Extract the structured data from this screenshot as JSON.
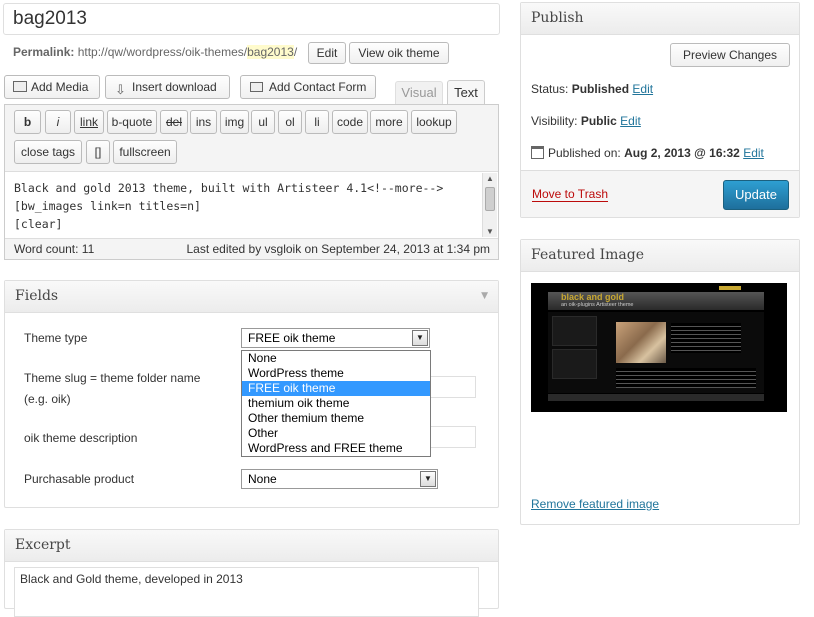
{
  "post": {
    "title": "bag2013",
    "permalink_label": "Permalink:",
    "permalink_base": "http://qw/wordpress/oik-themes/",
    "permalink_slug": "bag2013",
    "permalink_end": "/",
    "edit_button": "Edit",
    "view_button": "View oik theme"
  },
  "media_buttons": {
    "add_media": "Add Media",
    "insert_download": "Insert download",
    "add_contact_form": "Add Contact Form"
  },
  "editor_tabs": {
    "visual": "Visual",
    "text": "Text"
  },
  "quicktags": [
    "b",
    "i",
    "link",
    "b-quote",
    "del",
    "ins",
    "img",
    "ul",
    "ol",
    "li",
    "code",
    "more",
    "lookup",
    "close tags",
    "[]",
    "fullscreen"
  ],
  "editor": {
    "lines": [
      "Black and gold 2013 theme, built with Artisteer 4.1<!--more-->",
      "[bw_images link=n titles=n]",
      "[clear]"
    ],
    "word_count": "Word count: 11",
    "last_edited": "Last edited by vsgloik on September 24, 2013 at 1:34 pm"
  },
  "fields": {
    "title": "Fields",
    "theme_type_label": "Theme type",
    "theme_type_value": "FREE oik theme",
    "theme_type_options": [
      "None",
      "WordPress theme",
      "FREE oik theme",
      "themium oik theme",
      "Other themium theme",
      "Other",
      "WordPress and FREE theme"
    ],
    "slug_label_1": "Theme slug = theme folder name",
    "slug_label_2": "(e.g. oik)",
    "description_label": "oik theme description",
    "purchasable_label": "Purchasable product",
    "purchasable_value": "None"
  },
  "excerpt": {
    "title": "Excerpt",
    "text": "Black and Gold theme, developed in 2013"
  },
  "publish": {
    "title": "Publish",
    "preview_button": "Preview Changes",
    "status_label": "Status:",
    "status_value": "Published",
    "visibility_label": "Visibility:",
    "visibility_value": "Public",
    "published_label": "Published on:",
    "published_value": "Aug 2, 2013 @ 16:32",
    "edit_link": "Edit",
    "trash_link": "Move to Trash",
    "update_button": "Update"
  },
  "featured": {
    "title": "Featured Image",
    "thumb_title": "black and gold",
    "thumb_subtitle": "an oik-plugins Artisteer theme",
    "remove_link": "Remove featured image"
  },
  "colors": {
    "link": "#21759b",
    "update_bg": "#2e8bc2",
    "selected_option": "#3399ff",
    "trash": "#bc0b0b",
    "gold": "#c8a832"
  }
}
